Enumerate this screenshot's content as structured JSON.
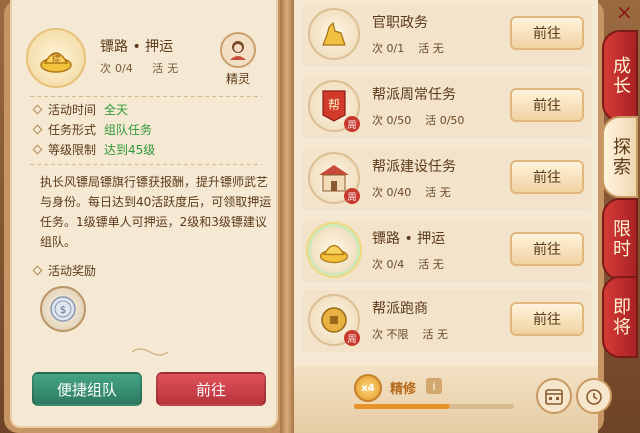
{
  "left": {
    "title": "镖路 • 押运",
    "stats": {
      "times_label": "次",
      "times": "0/4",
      "active_label": "活",
      "active": "无"
    },
    "sprite_label": "精灵",
    "info": [
      {
        "key": "活动时间",
        "value": "全天"
      },
      {
        "key": "任务形式",
        "value": "组队任务"
      },
      {
        "key": "等级限制",
        "value": "达到45级"
      }
    ],
    "description": "执长风镖局镖旗行镖获报酬，提升镖师武艺与身份。每日达到40活跃度后，可领取押运任务。1级镖单人可押运，2级和3级镖建议组队。",
    "reward_label": "活动奖励",
    "btn_team": "便捷组队",
    "btn_go": "前往"
  },
  "tasks": [
    {
      "title": "官职政务",
      "times_label": "次",
      "times": "0/1",
      "active_label": "活",
      "active": "无",
      "btn": "前往",
      "icon": "golden-deer-icon",
      "badge": ""
    },
    {
      "title": "帮派周常任务",
      "times_label": "次",
      "times": "0/50",
      "active_label": "活",
      "active": "0/50",
      "btn": "前往",
      "icon": "guild-banner-icon",
      "badge": "周"
    },
    {
      "title": "帮派建设任务",
      "times_label": "次",
      "times": "0/40",
      "active_label": "活",
      "active": "无",
      "btn": "前往",
      "icon": "building-icon",
      "badge": "周"
    },
    {
      "title": "镖路 • 押运",
      "times_label": "次",
      "times": "0/4",
      "active_label": "活",
      "active": "无",
      "btn": "前往",
      "icon": "gold-ingot-icon",
      "badge": ""
    },
    {
      "title": "帮派跑商",
      "times_label": "次",
      "times": "不限",
      "active_label": "活",
      "active": "无",
      "btn": "前往",
      "icon": "coin-icon",
      "badge": "周"
    }
  ],
  "bottom": {
    "multiplier": "x4",
    "label": "精修",
    "info": "i",
    "progress": 0.6
  },
  "tabs": [
    "成长",
    "探索",
    "限时",
    "即将"
  ],
  "close": "×",
  "colors": {
    "accent_green": "#2f9a39",
    "tab_red": "#c42a28",
    "progress": "#e8922a"
  }
}
